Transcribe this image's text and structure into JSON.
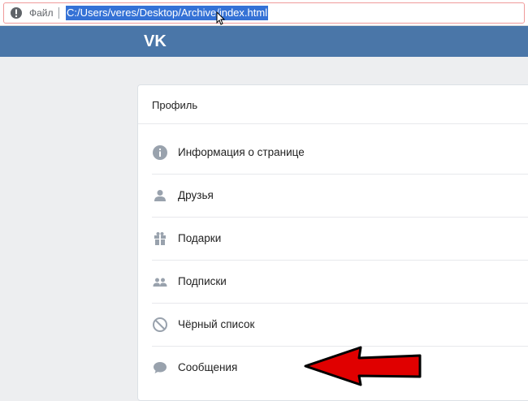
{
  "browser": {
    "file_label": "Файл",
    "url": "C:/Users/veres/Desktop/Archive/index.html"
  },
  "header": {
    "logo": "VK",
    "color": "#4a76a8"
  },
  "card": {
    "title": "Профиль",
    "items": [
      {
        "label": "Информация о странице",
        "icon": "info-icon"
      },
      {
        "label": "Друзья",
        "icon": "person-icon"
      },
      {
        "label": "Подарки",
        "icon": "gift-icon"
      },
      {
        "label": "Подписки",
        "icon": "people-icon"
      },
      {
        "label": "Чёрный список",
        "icon": "block-icon"
      },
      {
        "label": "Сообщения",
        "icon": "message-icon"
      }
    ]
  },
  "annotation": {
    "arrow_color": "#e00000",
    "arrow_points_to": "Сообщения"
  }
}
